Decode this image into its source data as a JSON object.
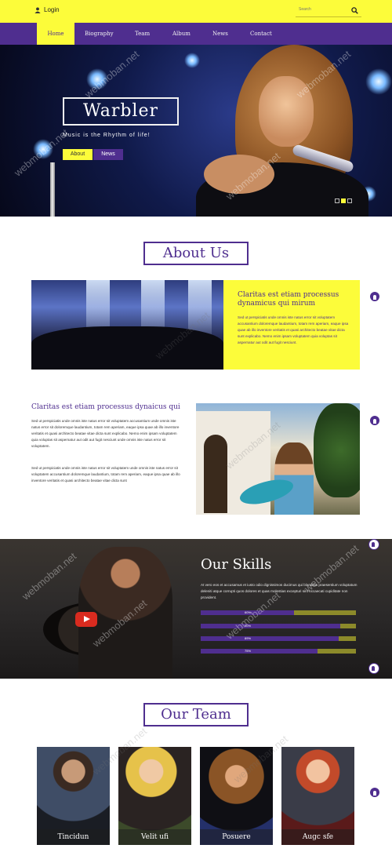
{
  "topbar": {
    "login_label": "Login",
    "search_placeholder": "Search"
  },
  "nav": {
    "items": [
      "Home",
      "Biography",
      "Team",
      "Album",
      "News",
      "Contact"
    ],
    "active": "Home"
  },
  "hero": {
    "title": "Warbler",
    "subtitle": "Music is the Rhythm of life!",
    "buttons": [
      "About",
      "News"
    ],
    "slides": 3,
    "active_slide": 2
  },
  "about": {
    "heading": "About Us",
    "card_title": "Claritas est etiam processus dynamicus qui mirum",
    "card_text": "Sed ut perspiciatis unde omnis iste natus error sit voluptatem accusantium doloremque laudantium, totam rem aperiam, eaque ipsa quae ab illo inventore veritatis et quasi architecto beatae vitae dicta sunt explicabo. Nemo enim ipsam voluptatem quia voluptas sit aspernatur aut odit aut fugit nesciunt.",
    "block2_title": "Claritas est etiam processus dynaicus qui",
    "block2_p1": "Sed ut perspiciatis unde omnis iste natus error sit voluptatem accusantium unde omnis iste natus error sit doloremque laudantium, totam rem aperiam, eaque ipsa quae ab illo inventore veritatis et quasi architecto beatae vitae dicta sunt explicabo. Nemo enim ipsam voluptatem quia voluptas sit aspernatur aut odit aut fugit nesciunt unde omnis iste natus error sit voluptatem.",
    "block2_p2": "Sed ut perspiciatis unde omnis iste natus error sit voluptatem unde omnis iste natus error sit voluptatem accusantium doloremque laudantium, totam rem aperiam, eaque ipsa quae ab illo inventore veritatis et quasi architecto beatae vitae dicta sunt"
  },
  "skills": {
    "heading": "Our Skills",
    "text": "At vero eos et accusamus et iusto odio dignissimos ducimus qui blanditiis praesentium voluptatum deleniti atque corrupti quos dolores et quas molestias excepturi sint occaecati cupiditate non provident.",
    "bars": [
      {
        "label": "60%",
        "value": 60
      },
      {
        "label": "90%",
        "value": 90
      },
      {
        "label": "89%",
        "value": 89
      },
      {
        "label": "75%",
        "value": 75
      }
    ]
  },
  "team": {
    "heading": "Our Team",
    "members": [
      "Tincidun",
      "Velit ufi",
      "Posuere",
      "Augc sfe"
    ]
  },
  "watermark": "webmoban.net",
  "colors": {
    "accent_yellow": "#fcfc3a",
    "accent_purple": "#4f2e8f"
  }
}
